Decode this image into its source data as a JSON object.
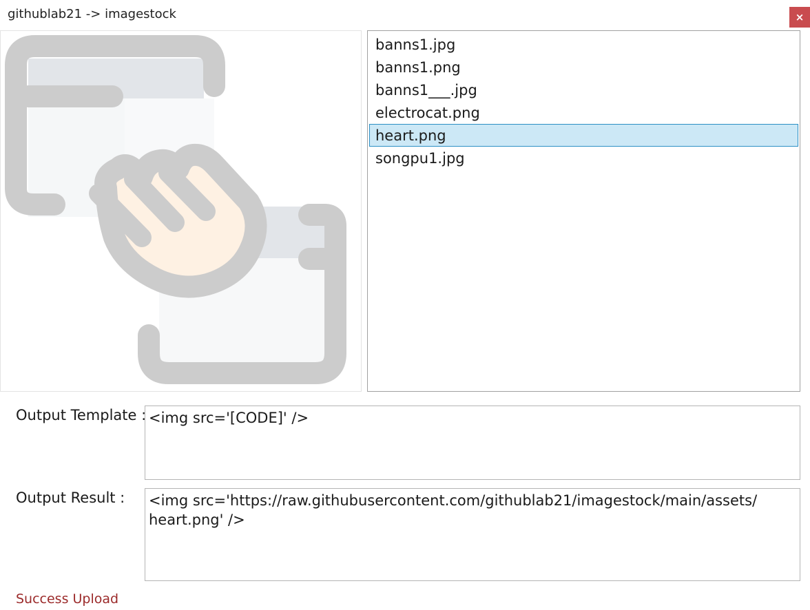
{
  "window": {
    "title": "githublab21 -> imagestock",
    "close_label": "×"
  },
  "preview": {
    "icon": "drag-and-drop-hand-icon",
    "colors": {
      "outline": "#cccccc",
      "panel_top": "#e2e5e9",
      "panel_body": "#f7f8f9",
      "hand_fill": "#fef1e3"
    }
  },
  "file_list": {
    "items": [
      {
        "name": "banns1.jpg",
        "selected": false
      },
      {
        "name": "banns1.png",
        "selected": false
      },
      {
        "name": "banns1___.jpg",
        "selected": false
      },
      {
        "name": "electrocat.png",
        "selected": false
      },
      {
        "name": "heart.png",
        "selected": true
      },
      {
        "name": "songpu1.jpg",
        "selected": false
      }
    ]
  },
  "output_template": {
    "label": "Output Template :",
    "value": "<img src='[CODE]' />"
  },
  "output_result": {
    "label": "Output Result :",
    "value": "<img src='https://raw.githubusercontent.com/githublab21/imagestock/main/assets/\nheart.png' />"
  },
  "status": {
    "text": "Success Upload",
    "color": "#9b2a2a"
  }
}
